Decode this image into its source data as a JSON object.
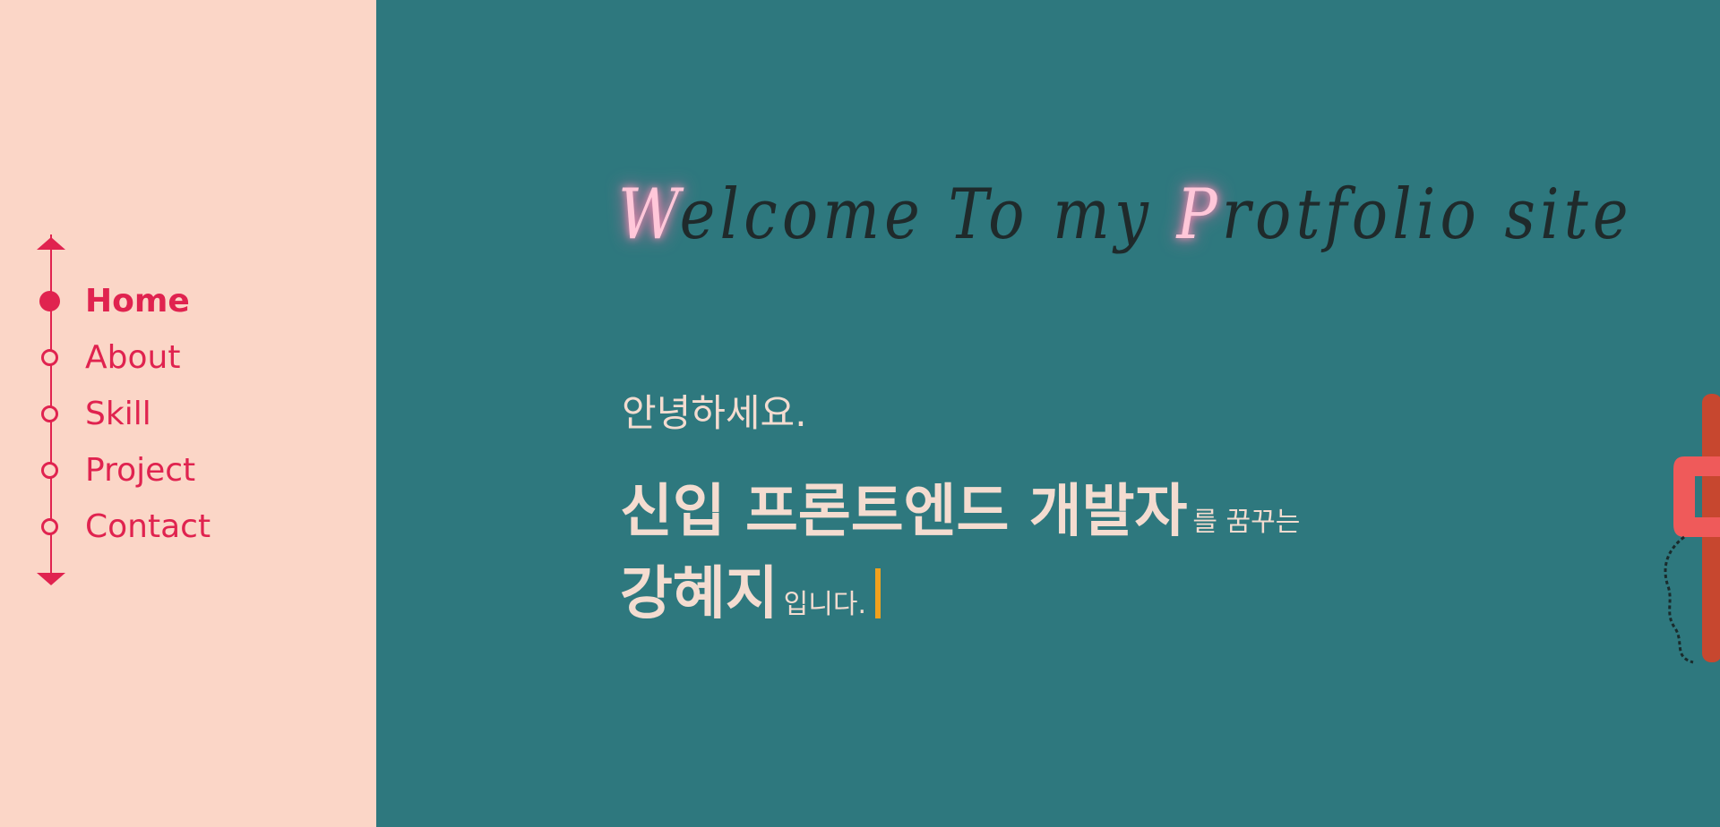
{
  "sidebar": {
    "nav": [
      {
        "label": "Home",
        "active": true
      },
      {
        "label": "About",
        "active": false
      },
      {
        "label": "Skill",
        "active": false
      },
      {
        "label": "Project",
        "active": false
      },
      {
        "label": "Contact",
        "active": false
      }
    ]
  },
  "hero": {
    "title_first": "W",
    "title_mid": "elcome To my ",
    "title_p": "P",
    "title_end": "rotfolio site",
    "greeting": "안녕하세요.",
    "role_big": "신입 프론트엔드 개발자",
    "role_small": "를 꿈꾸는",
    "name_big": "강혜지",
    "name_small": "입니다."
  },
  "colors": {
    "sidebar_bg": "#fbd6c7",
    "main_bg": "#2e787e",
    "accent": "#e0234f",
    "cursor": "#f0a11d"
  },
  "icons": {
    "phone": "telephone-handset-icon",
    "up": "arrow-up-icon",
    "down": "arrow-down-icon"
  }
}
